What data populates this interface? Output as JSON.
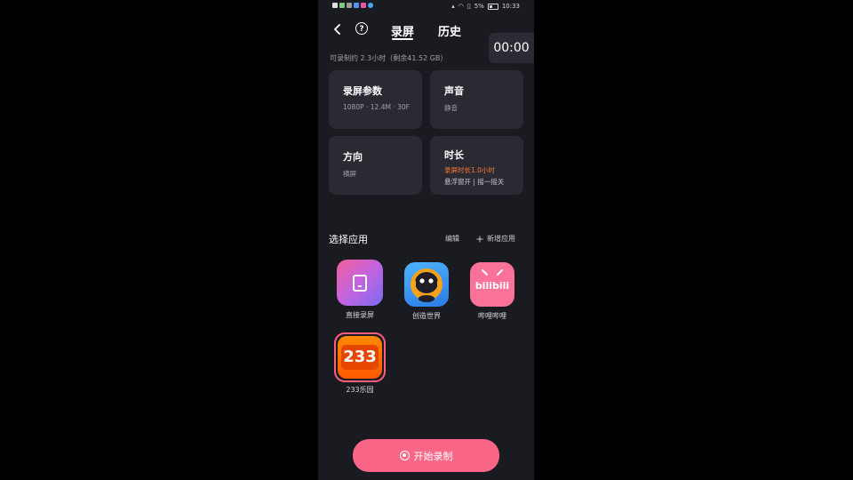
{
  "status_bar": {
    "battery": "5%",
    "time": "10:33"
  },
  "header": {
    "tabs": [
      "录屏",
      "历史"
    ],
    "active_tab": "录屏"
  },
  "timer": "00:00",
  "storage_info": "可录制约 2.3小时（剩余41.52 GB）",
  "settings": {
    "params": {
      "title": "录屏参数",
      "value": "1080P · 12.4M · 30F"
    },
    "sound": {
      "title": "声音",
      "value": "静音"
    },
    "orientation": {
      "title": "方向",
      "value": "横屏"
    },
    "duration": {
      "title": "时长",
      "accent": "录屏时长1.0小时",
      "value": "悬浮窗开 | 摇一摇关"
    }
  },
  "apps_section": {
    "title": "选择应用",
    "edit_label": "编辑",
    "add_label": "新增应用",
    "apps": [
      {
        "label": "直接录屏",
        "icon": "screen-record-icon"
      },
      {
        "label": "创造世界",
        "icon": "mini-world-icon"
      },
      {
        "label": "哔哩哔哩",
        "icon": "bilibili-icon",
        "icon_text": "bilibili"
      },
      {
        "label": "233乐园",
        "icon": "233-park-icon",
        "icon_text": "233"
      }
    ]
  },
  "start_button": {
    "label": "开始录制"
  },
  "colors": {
    "background": "#1a1a21",
    "card": "#2a2a33",
    "accent_pink": "#fa6688",
    "accent_orange": "#ff7a2e"
  }
}
